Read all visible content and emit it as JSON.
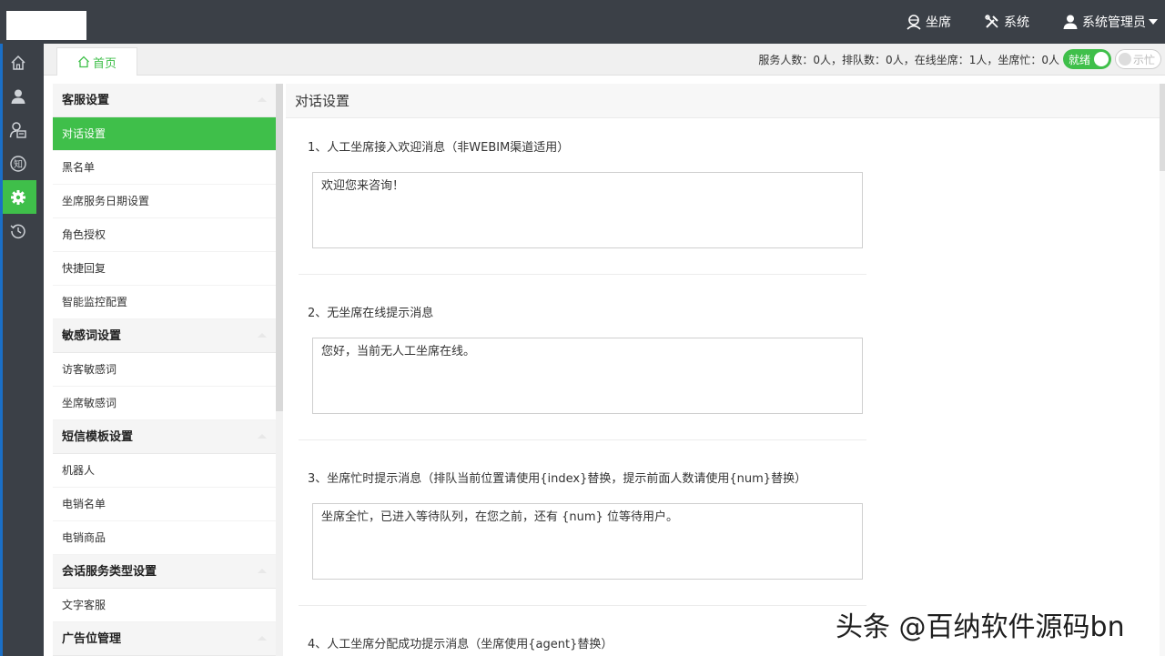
{
  "header": {
    "nav": [
      {
        "label": "坐席",
        "icon": "agent-icon"
      },
      {
        "label": "系统",
        "icon": "tools-icon"
      },
      {
        "label": "系统管理员",
        "icon": "user-icon"
      }
    ]
  },
  "rail": {
    "icons": [
      "home-icon",
      "user-icon",
      "agent-card-icon",
      "knowledge-icon",
      "gear-icon",
      "history-icon"
    ],
    "active_index": 4
  },
  "tabs": {
    "home": "首页"
  },
  "status": {
    "text": "服务人数：0人，排队数：0人，在线坐席：1人，坐席忙：0人",
    "ready_label": "就绪",
    "busy_label": "示忙"
  },
  "menu": {
    "groups": [
      {
        "title": "客服设置",
        "items": [
          "对话设置",
          "黑名单",
          "坐席服务日期设置",
          "角色授权",
          "快捷回复",
          "智能监控配置"
        ]
      },
      {
        "title": "敏感词设置",
        "items": [
          "访客敏感词",
          "坐席敏感词"
        ]
      },
      {
        "title": "短信模板设置",
        "items": [
          "机器人",
          "电销名单",
          "电销商品"
        ]
      },
      {
        "title": "会话服务类型设置",
        "items": [
          "文字客服"
        ]
      },
      {
        "title": "广告位管理",
        "items": []
      }
    ],
    "active_item": "对话设置"
  },
  "content": {
    "title": "对话设置",
    "sections": [
      {
        "label": "1、人工坐席接入欢迎消息（非WEBIM渠道适用）",
        "value": "欢迎您来咨询！"
      },
      {
        "label": "2、无坐席在线提示消息",
        "value": "您好，当前无人工坐席在线。"
      },
      {
        "label": "3、坐席忙时提示消息（排队当前位置请使用{index}替换，提示前面人数请使用{num}替换）",
        "value": "坐席全忙，已进入等待队列，在您之前，还有 {num} 位等待用户。"
      },
      {
        "label": "4、人工坐席分配成功提示消息（坐席使用{agent}替换）",
        "value": ""
      }
    ]
  },
  "watermark": "头条 @百纳软件源码bn",
  "colors": {
    "accent": "#3fbf4a",
    "header_bg": "#3b4047"
  }
}
